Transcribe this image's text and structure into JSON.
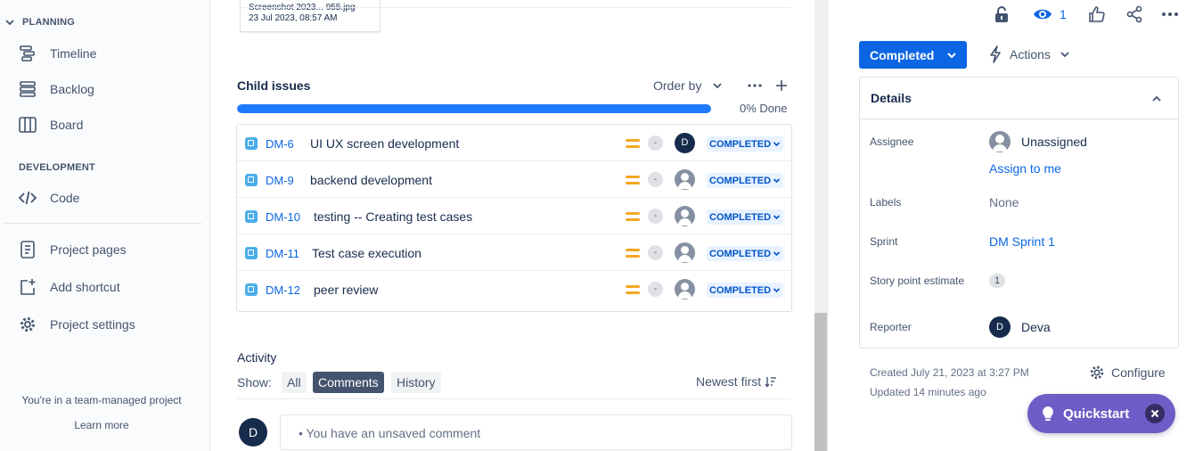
{
  "sidebar": {
    "planning_header": "PLANNING",
    "planning_items": [
      {
        "label": "Timeline",
        "icon": "timeline-icon"
      },
      {
        "label": "Backlog",
        "icon": "backlog-icon"
      },
      {
        "label": "Board",
        "icon": "board-icon"
      }
    ],
    "development_header": "DEVELOPMENT",
    "code_label": "Code",
    "project_pages_label": "Project pages",
    "add_shortcut_label": "Add shortcut",
    "project_settings_label": "Project settings",
    "team_note": "You're in a team-managed project",
    "learn_more": "Learn more"
  },
  "attachment": {
    "filename": "Screenshot 2023... 955.jpg",
    "date": "23 Jul 2023, 08:57 AM"
  },
  "child_issues": {
    "title": "Child issues",
    "order_by_label": "Order by",
    "progress_percent": 0,
    "progress_label": "0% Done",
    "items": [
      {
        "key": "DM-6",
        "summary": "UI UX screen development",
        "estimate": "-",
        "assignee": "D",
        "status": "COMPLETED"
      },
      {
        "key": "DM-9",
        "summary": "backend development",
        "estimate": "-",
        "assignee": "",
        "status": "COMPLETED"
      },
      {
        "key": "DM-10",
        "summary": "testing -- Creating test cases",
        "estimate": "-",
        "assignee": "",
        "status": "COMPLETED"
      },
      {
        "key": "DM-11",
        "summary": "Test case execution",
        "estimate": "-",
        "assignee": "",
        "status": "COMPLETED"
      },
      {
        "key": "DM-12",
        "summary": "peer review",
        "estimate": "-",
        "assignee": "",
        "status": "COMPLETED"
      }
    ]
  },
  "activity": {
    "title": "Activity",
    "show_label": "Show:",
    "filters": [
      "All",
      "Comments",
      "History"
    ],
    "active_filter": "Comments",
    "sort_label": "Newest first",
    "comment_avatar": "D",
    "comment_placeholder": "• You have an unsaved comment"
  },
  "right_panel": {
    "watch_count": "1",
    "status_button": "Completed",
    "actions_label": "Actions",
    "details_title": "Details",
    "fields": {
      "assignee_label": "Assignee",
      "assignee_value": "Unassigned",
      "assign_to_me": "Assign to me",
      "labels_label": "Labels",
      "labels_value": "None",
      "sprint_label": "Sprint",
      "sprint_value": "DM Sprint 1",
      "story_points_label": "Story point estimate",
      "story_points_value": "1",
      "reporter_label": "Reporter",
      "reporter_initial": "D",
      "reporter_value": "Deva"
    },
    "created": "Created July 21, 2023 at 3:27 PM",
    "updated": "Updated 14 minutes ago",
    "configure_label": "Configure"
  },
  "quickstart": {
    "label": "Quickstart"
  },
  "colors": {
    "primary": "#0c66e4",
    "progress": "#1d7afc",
    "priority_medium": "#f5a623",
    "quickstart": "#6e5dc6",
    "story_icon": "#4bade8"
  }
}
